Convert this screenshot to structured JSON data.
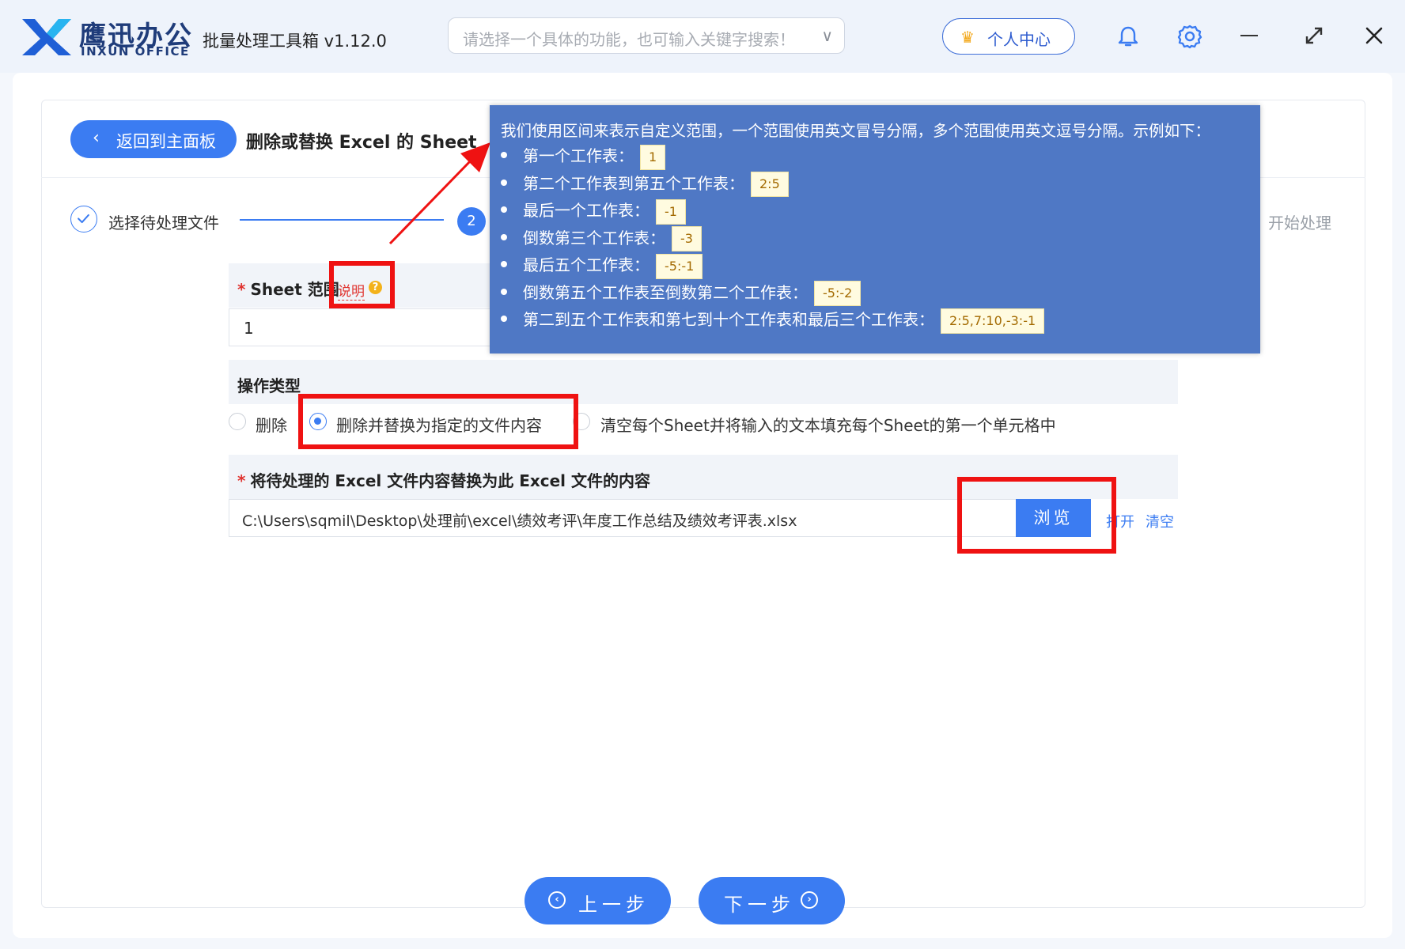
{
  "app": {
    "brand_cn": "鹰迅办公",
    "brand_en": "INXUN OFFICE",
    "title": "批量处理工具箱 v1.12.0",
    "search_placeholder": "请选择一个具体的功能，也可输入关键字搜索！",
    "user_center": "个人中心",
    "accent_color": "#3b7cf2"
  },
  "page": {
    "back_label": "返回到主面板",
    "title": "删除或替换 Excel 的 Sheet"
  },
  "steps": {
    "step1_label": "选择待处理文件",
    "step2_number": "2",
    "step3_label": "开始处理"
  },
  "form": {
    "sheet_range_label": "Sheet 范围",
    "explain_link": "说明",
    "sheet_range_value": "1",
    "operation_label": "操作类型",
    "options": [
      "删除",
      "删除并替换为指定的文件内容",
      "清空每个Sheet并将输入的文本填充每个Sheet的第一个单元格中"
    ],
    "selected_option": 1,
    "replace_file_label": "将待处理的 Excel 文件内容替换为此 Excel 文件的内容",
    "replace_file_value": "C:\\Users\\sqmil\\Desktop\\处理前\\excel\\绩效考评\\年度工作总结及绩效考评表.xlsx",
    "browse_label": "浏览",
    "open_label": "打开",
    "clear_label": "清空"
  },
  "tooltip": {
    "heading": "我们使用区间来表示自定义范围，一个范围使用英文冒号分隔，多个范围使用英文逗号分隔。示例如下：",
    "items": [
      {
        "text": "第一个工作表：",
        "code": "1"
      },
      {
        "text": "第二个工作表到第五个工作表：",
        "code": "2:5"
      },
      {
        "text": "最后一个工作表：",
        "code": "-1"
      },
      {
        "text": "倒数第三个工作表：",
        "code": "-3"
      },
      {
        "text": "最后五个工作表：",
        "code": "-5:-1"
      },
      {
        "text": "倒数第五个工作表至倒数第二个工作表：",
        "code": "-5:-2"
      },
      {
        "text": "第二到五个工作表和第七到十个工作表和最后三个工作表：",
        "code": "2:5,7:10,-3:-1"
      }
    ]
  },
  "nav": {
    "prev_label": "上一步",
    "next_label": "下一步"
  }
}
